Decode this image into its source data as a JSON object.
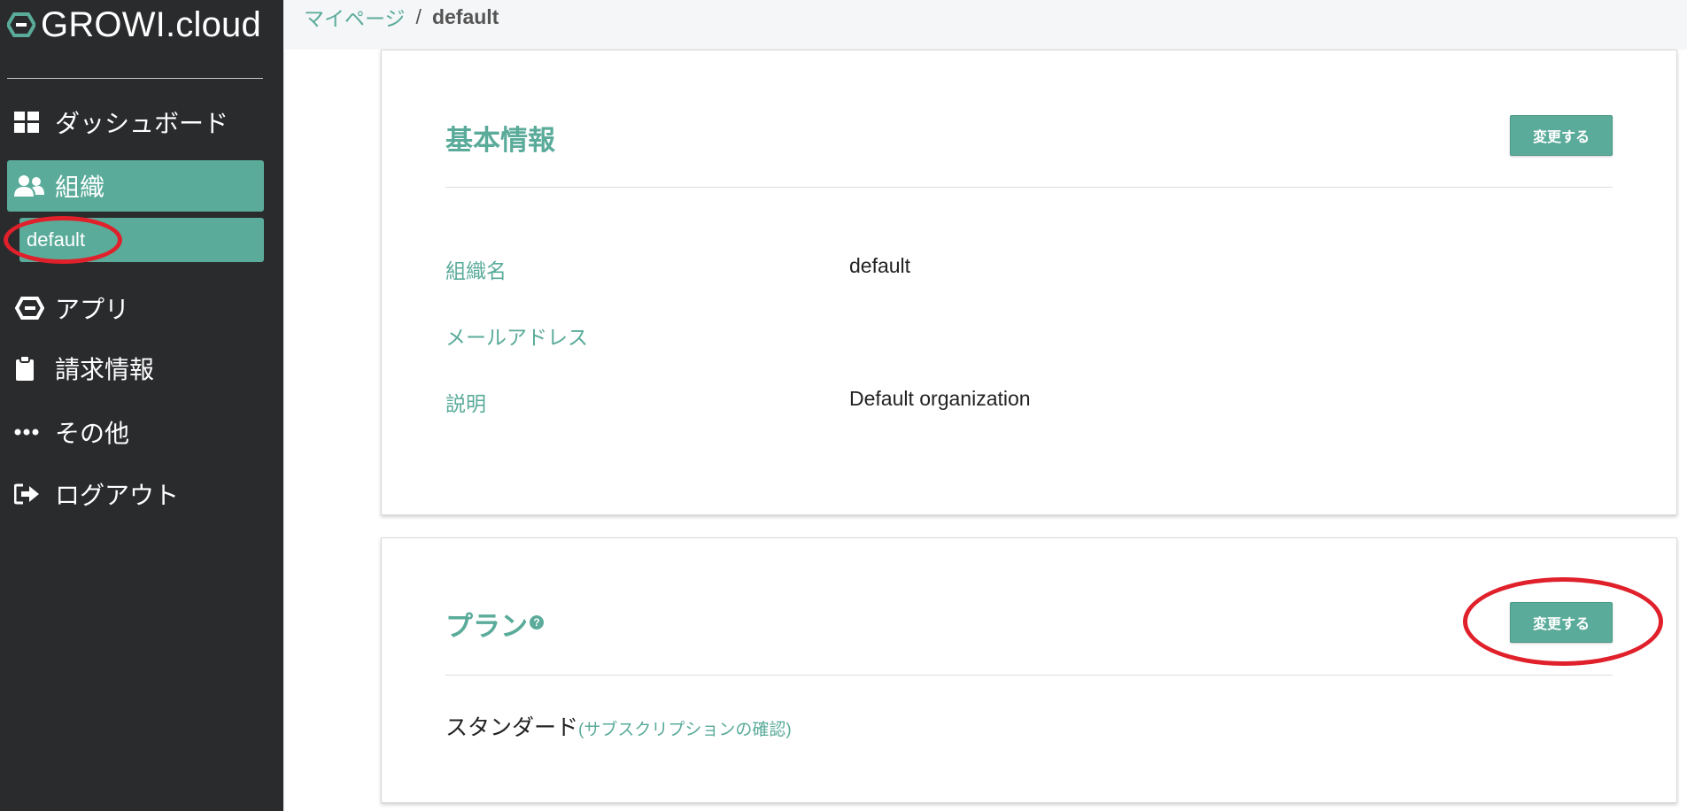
{
  "brand": {
    "name": "GROWI.cloud"
  },
  "sidebar": {
    "items": [
      {
        "label": "ダッシュボード",
        "icon": "dashboard-grid-icon"
      },
      {
        "label": "組織",
        "icon": "users-icon",
        "active": true
      },
      {
        "label": "アプリ",
        "icon": "growi-logo-icon"
      },
      {
        "label": "請求情報",
        "icon": "clipboard-icon"
      },
      {
        "label": "その他",
        "icon": "more-dots-icon"
      },
      {
        "label": "ログアウト",
        "icon": "sign-out-icon"
      }
    ],
    "sub_item": {
      "label": "default"
    }
  },
  "breadcrumb": {
    "parent": "マイページ",
    "separator": "/",
    "current": "default"
  },
  "basic_info": {
    "title": "基本情報",
    "edit_button": "変更する",
    "fields": [
      {
        "label": "組織名",
        "value": "default"
      },
      {
        "label": "メールアドレス",
        "value": ""
      },
      {
        "label": "説明",
        "value": "Default organization"
      }
    ]
  },
  "plan": {
    "title": "プラン",
    "help_icon": "question-circle-icon",
    "help_glyph": "?",
    "edit_button": "変更する",
    "plan_name": "スタンダード",
    "subscription_link": "(サブスクリプションの確認)"
  },
  "colors": {
    "accent": "#5aab9a",
    "sidebar_bg": "#2a2b2d",
    "annotation": "#e0202a"
  }
}
